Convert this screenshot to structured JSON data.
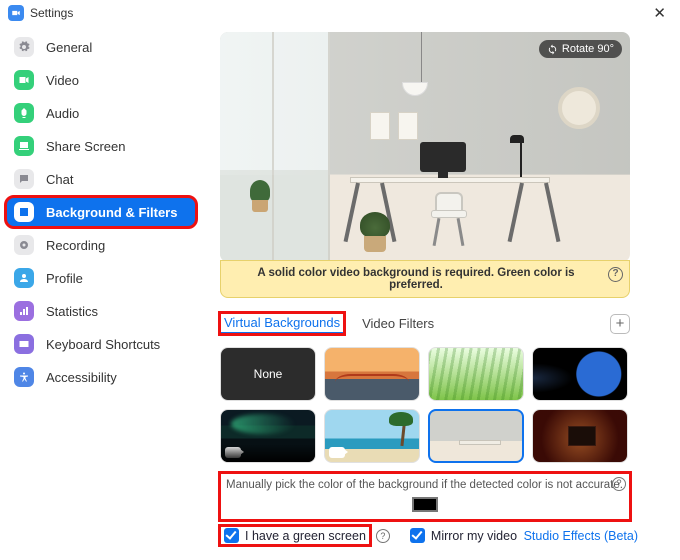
{
  "window": {
    "title": "Settings"
  },
  "sidebar": {
    "items": [
      {
        "label": "General",
        "icon": "gear-icon",
        "bg": "#e8e8ea",
        "fg": "#8a8a92"
      },
      {
        "label": "Video",
        "icon": "video-icon",
        "bg": "#34d07a",
        "fg": "#ffffff"
      },
      {
        "label": "Audio",
        "icon": "audio-icon",
        "bg": "#34d07a",
        "fg": "#ffffff"
      },
      {
        "label": "Share Screen",
        "icon": "share-icon",
        "bg": "#34d07a",
        "fg": "#ffffff"
      },
      {
        "label": "Chat",
        "icon": "chat-icon",
        "bg": "#e8e8ea",
        "fg": "#8a8a92"
      },
      {
        "label": "Background & Filters",
        "icon": "background-icon",
        "bg": "#ffffff",
        "fg": "#0e72ed",
        "active": true,
        "highlight": true
      },
      {
        "label": "Recording",
        "icon": "record-icon",
        "bg": "#e8e8ea",
        "fg": "#8a8a92"
      },
      {
        "label": "Profile",
        "icon": "profile-icon",
        "bg": "#3ba7e8",
        "fg": "#ffffff"
      },
      {
        "label": "Statistics",
        "icon": "stats-icon",
        "bg": "#9b6fe0",
        "fg": "#ffffff"
      },
      {
        "label": "Keyboard Shortcuts",
        "icon": "keyboard-icon",
        "bg": "#8b6fe0",
        "fg": "#ffffff"
      },
      {
        "label": "Accessibility",
        "icon": "accessibility-icon",
        "bg": "#4f86e6",
        "fg": "#ffffff"
      }
    ]
  },
  "preview": {
    "rotate_label": "Rotate 90°",
    "notice": "A solid color video background is required. Green color is preferred."
  },
  "tabs": {
    "items": [
      {
        "label": "Virtual Backgrounds",
        "active": true,
        "highlight": true
      },
      {
        "label": "Video Filters"
      }
    ]
  },
  "thumbs": {
    "none_label": "None"
  },
  "manual": {
    "text": "Manually pick the color of the background if the detected color is not accurate.",
    "color": "#000000"
  },
  "options": {
    "green_screen_label": "I have a green screen",
    "mirror_label": "Mirror my video",
    "studio_label": "Studio Effects (Beta)"
  }
}
